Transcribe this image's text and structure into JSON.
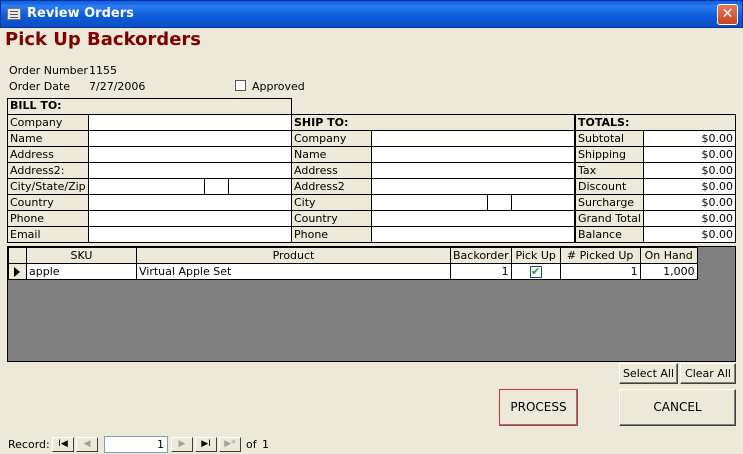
{
  "window": {
    "title": "Review Orders",
    "close": "✕"
  },
  "heading": "Pick Up Backorders",
  "order": {
    "number_label": "Order Number",
    "number": "1155",
    "date_label": "Order Date",
    "date": "7/27/2006",
    "approved_label": "Approved"
  },
  "bill_to": {
    "header": "BILL TO:",
    "labels": [
      "Company",
      "Name",
      "Address",
      "Address2:",
      "City/State/Zip",
      "Country",
      "Phone",
      "Email"
    ]
  },
  "ship_to": {
    "header": "SHIP TO:",
    "labels": [
      "Company",
      "Name",
      "Address",
      "Address2",
      "City",
      "Country",
      "Phone"
    ]
  },
  "totals": {
    "header": "TOTALS:",
    "rows": [
      {
        "label": "Subtotal",
        "value": "$0.00"
      },
      {
        "label": "Shipping",
        "value": "$0.00"
      },
      {
        "label": "Tax",
        "value": "$0.00"
      },
      {
        "label": "Discount",
        "value": "$0.00"
      },
      {
        "label": "Surcharge",
        "value": "$0.00"
      },
      {
        "label": "Grand Total",
        "value": "$0.00"
      },
      {
        "label": "Balance",
        "value": "$0.00"
      }
    ]
  },
  "grid": {
    "columns": [
      "SKU",
      "Product",
      "Backorder",
      "Pick Up",
      "# Picked Up",
      "On Hand"
    ],
    "rows": [
      {
        "sku": "apple",
        "product": "Virtual Apple Set",
        "backorder": "1",
        "pickup": "✔",
        "picked_up": "1",
        "on_hand": "1,000"
      }
    ]
  },
  "buttons": {
    "select_all": "Select All",
    "clear_all": "Clear All",
    "process": "PROCESS",
    "cancel": "CANCEL"
  },
  "record_nav": {
    "label": "Record:",
    "current": "1",
    "of_label": "of",
    "total": "1",
    "first": "I◀",
    "prev": "◀",
    "next": "▶",
    "last": "▶I",
    "new": "▶*"
  }
}
